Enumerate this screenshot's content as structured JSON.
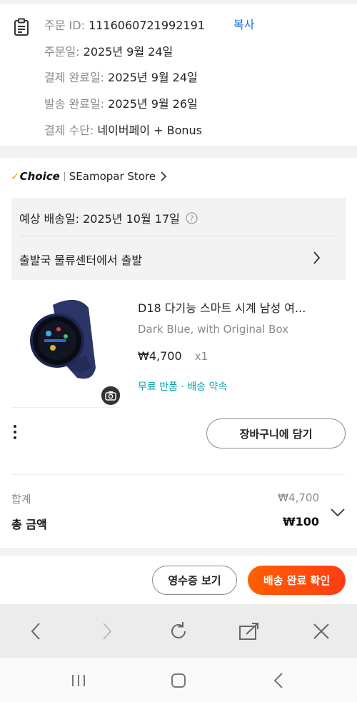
{
  "order": {
    "id_label": "주문 ID:",
    "id_value": "1116060721992191",
    "copy_label": "복사",
    "order_date_label": "주문일:",
    "order_date_value": "2025년 9월 24일",
    "paid_label": "결제 완료일:",
    "paid_value": "2025년 9월 24일",
    "shipped_label": "발송 완료일:",
    "shipped_value": "2025년 9월 26일",
    "payment_label": "결제 수단:",
    "payment_value": "네이버페이 + Bonus"
  },
  "store": {
    "badge": "Choice",
    "name": "SEamopar Store"
  },
  "delivery": {
    "eta_label": "예상 배송일:",
    "eta_value": "2025년 10월 17일",
    "status": "출발국 물류센터에서 출발"
  },
  "product": {
    "title": "D18 다기능 스마트 시계 남성 여...",
    "variant": "Dark Blue, with Original Box",
    "price": "₩4,700",
    "qty": "x1",
    "tags": "무료 반품 · 배송 약속"
  },
  "actions": {
    "add_to_cart": "장바구니에 담기"
  },
  "summary": {
    "subtotal_label": "합계",
    "subtotal_value": "₩4,700",
    "total_label": "총 금액",
    "total_value": "₩100"
  },
  "bottom": {
    "receipt_button": "영수증 보기",
    "confirm_button": "배송 완료 확인"
  },
  "colors": {
    "accent_blue": "#1a73d9",
    "tag_teal": "#0fa0a8",
    "confirm_orange": "#fe4a08",
    "choice_orange": "#f7a400"
  },
  "icons": [
    "clipboard-icon",
    "help-icon",
    "chevron-right-icon",
    "camera-icon",
    "more-vert-icon",
    "chevron-down-icon",
    "back-icon",
    "forward-icon",
    "refresh-icon",
    "share-icon",
    "close-icon",
    "recent-apps-icon",
    "home-icon",
    "system-back-icon"
  ]
}
